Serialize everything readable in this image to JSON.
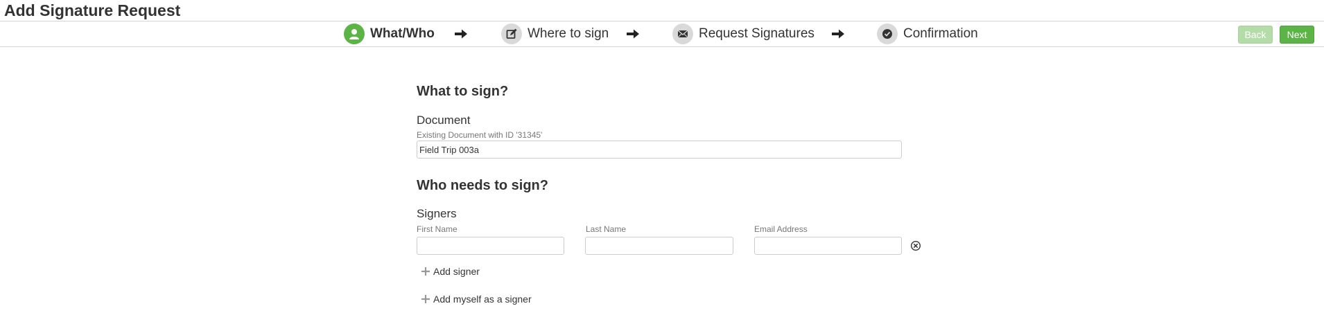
{
  "page": {
    "title": "Add Signature Request"
  },
  "wizard": {
    "steps": [
      {
        "label": "What/Who",
        "icon": "person-icon",
        "active": true
      },
      {
        "label": "Where to sign",
        "icon": "edit-icon",
        "active": false
      },
      {
        "label": "Request Signatures",
        "icon": "envelope-icon",
        "active": false
      },
      {
        "label": "Confirmation",
        "icon": "check-circle-icon",
        "active": false
      }
    ],
    "back_label": "Back",
    "next_label": "Next"
  },
  "what": {
    "heading": "What to sign?",
    "document_label": "Document",
    "document_hint": "Existing Document with ID '31345'",
    "document_value": "Field Trip 003a"
  },
  "who": {
    "heading": "Who needs to sign?",
    "signers_label": "Signers",
    "columns": {
      "first_name": "First Name",
      "last_name": "Last Name",
      "email": "Email Address"
    },
    "signer": {
      "first_name": "",
      "last_name": "",
      "email": ""
    },
    "add_signer_label": "Add signer",
    "add_myself_label": "Add myself as a signer"
  },
  "colors": {
    "accent": "#5cb446",
    "accent_disabled": "#b3dca8",
    "inactive_step": "#d9d9d9",
    "text": "#333333",
    "hint": "#777777"
  }
}
